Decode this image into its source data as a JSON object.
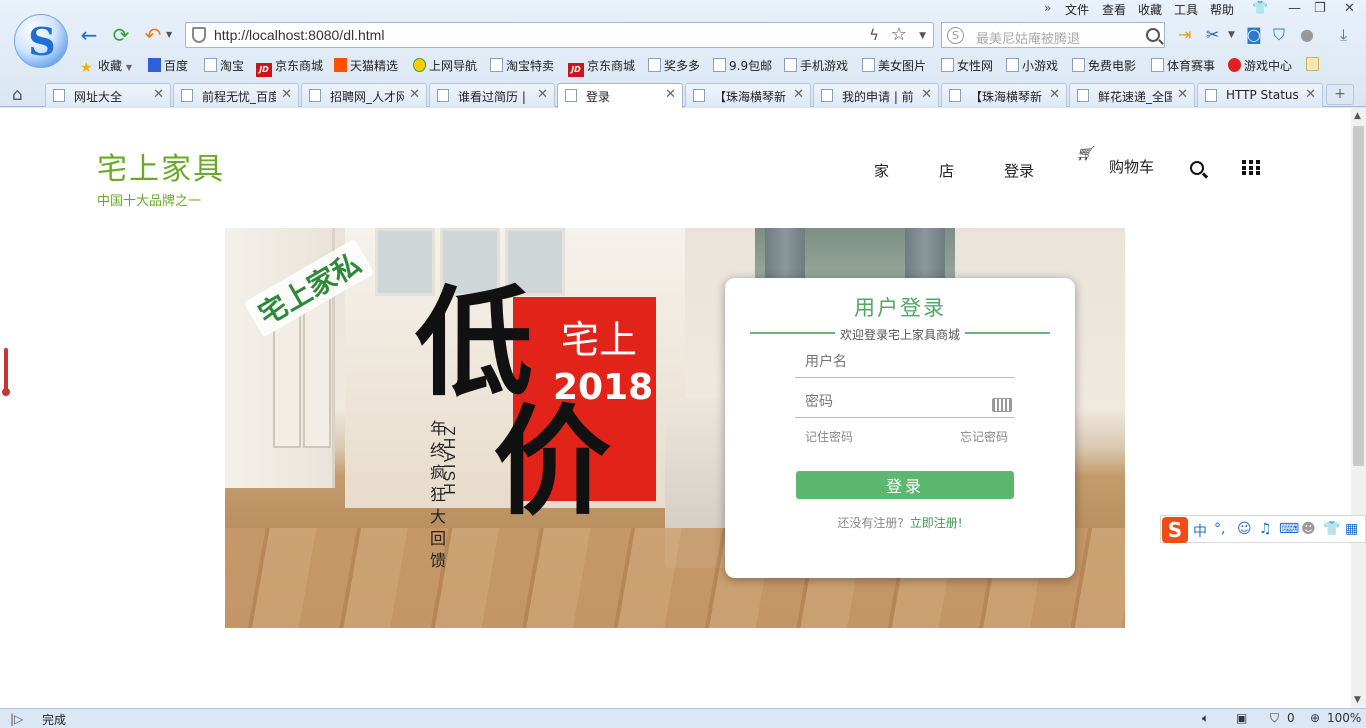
{
  "browser": {
    "url": "http://localhost:8080/dl.html",
    "search_placeholder": "最美尼姑庵被腾退",
    "menu": [
      "文件",
      "查看",
      "收藏",
      "工具",
      "帮助"
    ],
    "menu_expand": "»",
    "favorites": [
      "收藏",
      "百度",
      "淘宝",
      "京东商城",
      "天猫精选",
      "上网导航",
      "淘宝特卖",
      "京东商城",
      "奖多多",
      "9.9包邮",
      "手机游戏",
      "美女图片",
      "女性网",
      "小游戏",
      "免费电影",
      "体育赛事",
      "游戏中心"
    ],
    "tabs": [
      {
        "label": "网址大全",
        "active": false
      },
      {
        "label": "前程无忧_百度",
        "active": false
      },
      {
        "label": "招聘网_人才网",
        "active": false
      },
      {
        "label": "谁看过简历 |",
        "active": false
      },
      {
        "label": "登录",
        "active": true
      },
      {
        "label": "【珠海横琴新",
        "active": false
      },
      {
        "label": "我的申请 | 前",
        "active": false
      },
      {
        "label": "【珠海横琴新",
        "active": false
      },
      {
        "label": "鲜花速递_全国",
        "active": false
      },
      {
        "label": "HTTP Status",
        "active": false
      }
    ],
    "status_text": "完成",
    "status_count": "0",
    "zoom": "100%"
  },
  "site": {
    "logo_title": "宅上家具",
    "logo_sub": "中国十大品牌之一",
    "nav": {
      "home": "家",
      "store": "店",
      "login": "登录",
      "cart": "购物车"
    }
  },
  "banner": {
    "stamp": "宅上家私",
    "red_top": "宅上",
    "red_year": "2018",
    "big_char_1": "低",
    "big_char_2": "价",
    "vertical_cn": "年终疯狂大回馈",
    "vertical_latin": "ZHAISH"
  },
  "login": {
    "title": "用户登录",
    "subtitle": "欢迎登录宅上家具商城",
    "username_placeholder": "用户名",
    "password_placeholder": "密码",
    "remember": "记住密码",
    "forgot": "忘记密码",
    "submit": "登录",
    "no_account": "还没有注册?",
    "register_link": "立即注册!"
  },
  "ime": {
    "mode": "中"
  },
  "colors": {
    "accent_green": "#5cb86f",
    "logo_green": "#6aaa28",
    "banner_red": "#e2231a"
  }
}
